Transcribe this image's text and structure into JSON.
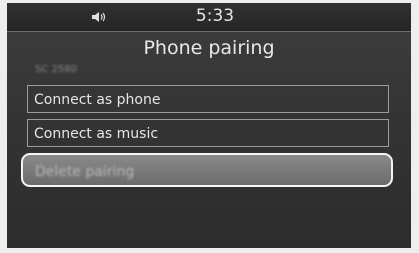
{
  "status": {
    "time": "5:33",
    "volume_icon": "speaker-icon"
  },
  "screen": {
    "title": "Phone pairing",
    "subtitle": "SC 2580"
  },
  "menu": {
    "items": [
      {
        "label": "Connect as phone"
      },
      {
        "label": "Connect as music"
      },
      {
        "label": "Delete pairing",
        "selected": true
      }
    ]
  },
  "colors": {
    "screen_bg": "#353535",
    "text": "#e6e6e6",
    "highlight": "#7a7a7a"
  }
}
